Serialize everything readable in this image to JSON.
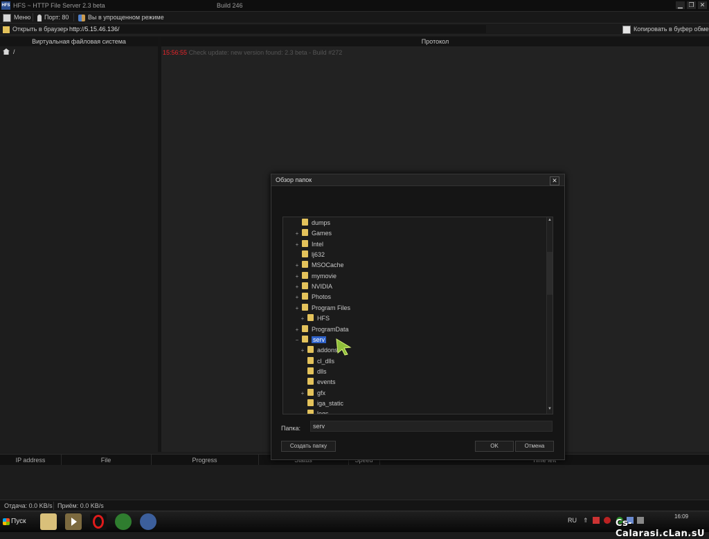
{
  "window": {
    "logo": "HFS",
    "title": "HFS ~ HTTP File Server 2.3 beta",
    "build": "Build 246",
    "buttons": {
      "minimize": "▁",
      "restore": "❐",
      "close": "✕"
    }
  },
  "menubar": {
    "menu": "Меню",
    "port": "Порт: 80",
    "mode": "Вы в упрощенном режиме"
  },
  "urlbar": {
    "open_label": "Открыть в браузере",
    "url": "http://5.15.46.136/",
    "copy_label": "Копировать в буфер обмена"
  },
  "vfs": {
    "header": "Виртуальная файловая система",
    "root": "/"
  },
  "log": {
    "header": "Протокол",
    "entries": [
      {
        "time": "15:56:55",
        "text": "Check update: new version found: 2.3 beta - Build #272"
      }
    ]
  },
  "transfers": {
    "columns": [
      "IP address",
      "File",
      "Progress",
      "Status",
      "Speed",
      "Time left"
    ]
  },
  "statusbar": {
    "out": "Отдача: 0.0 KB/s",
    "in": "Приём: 0.0 KB/s"
  },
  "dialog": {
    "title": "Обзор папок",
    "close": "✕",
    "tree": [
      {
        "label": "dumps",
        "expander": ""
      },
      {
        "label": "Games",
        "expander": "+"
      },
      {
        "label": "Intel",
        "expander": "+"
      },
      {
        "label": "lj632",
        "expander": ""
      },
      {
        "label": "MSOCache",
        "expander": "+"
      },
      {
        "label": "mymovie",
        "expander": "+"
      },
      {
        "label": "NVIDIA",
        "expander": "+"
      },
      {
        "label": "Photos",
        "expander": "+"
      },
      {
        "label": "Program Files",
        "expander": "+"
      },
      {
        "label": "HFS",
        "expander": "+"
      },
      {
        "label": "ProgramData",
        "expander": "+"
      },
      {
        "label": "serv",
        "expander": "−"
      },
      {
        "label": "addons",
        "expander": "+"
      },
      {
        "label": "cl_dlls",
        "expander": ""
      },
      {
        "label": "dlls",
        "expander": ""
      },
      {
        "label": "events",
        "expander": ""
      },
      {
        "label": "gfx",
        "expander": "+"
      },
      {
        "label": "iga_static",
        "expander": ""
      },
      {
        "label": "logs",
        "expander": ""
      }
    ],
    "folder_label": "Папка:",
    "folder_value": "serv",
    "create_button": "Создать папку",
    "ok_button": "OK",
    "cancel_button": "Отмена",
    "scroll_up": "▲",
    "scroll_down": "▼"
  },
  "taskbar": {
    "start": "Пуск",
    "lang": "RU",
    "clock": "16:09",
    "watermark": "Cs-Calarasi.cLan.sU"
  },
  "colors": {
    "log_time": "#e8242a",
    "selection": "#2f62c8",
    "folder": "#e3c25b"
  }
}
